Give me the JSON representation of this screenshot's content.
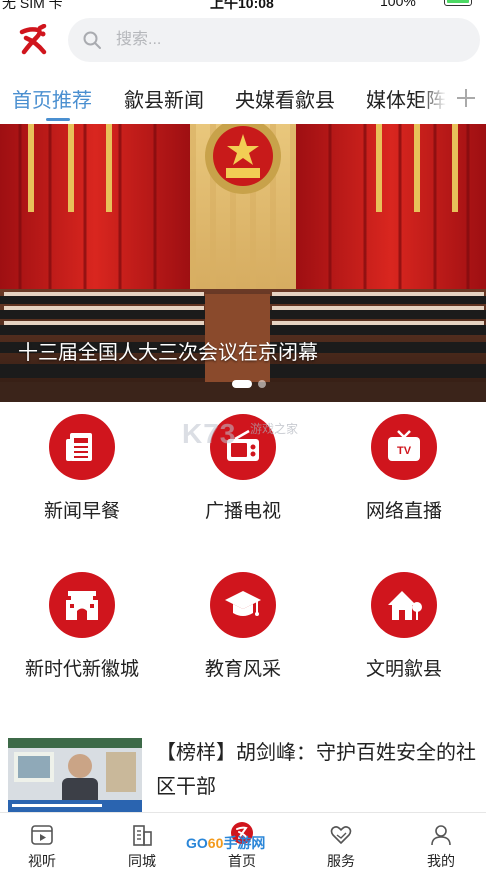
{
  "status_bar": {
    "carrier": "无 SIM 卡",
    "time": "上午10:08",
    "battery": "100%"
  },
  "header": {
    "logo_icon": "red-calligraphy-logo-icon",
    "search_placeholder": "搜索..."
  },
  "tabs": [
    {
      "label": "首页推荐",
      "active": true
    },
    {
      "label": "歙县新闻",
      "active": false
    },
    {
      "label": "央媒看歙县",
      "active": false
    },
    {
      "label": "媒体矩阵",
      "active": false
    }
  ],
  "banner": {
    "caption": "十三届全国人大三次会议在京闭幕",
    "slide_count": 2,
    "active_slide": 1
  },
  "grid": [
    {
      "label": "新闻早餐",
      "icon": "newspaper-icon"
    },
    {
      "label": "广播电视",
      "icon": "radio-icon"
    },
    {
      "label": "网络直播",
      "icon": "tv-live-icon"
    },
    {
      "label": "新时代新徽城",
      "icon": "city-gate-icon"
    },
    {
      "label": "教育风采",
      "icon": "graduation-cap-icon"
    },
    {
      "label": "文明歙县",
      "icon": "house-icon"
    }
  ],
  "watermark": {
    "text": "K73",
    "sub": "游戏之家"
  },
  "news": [
    {
      "title": "【榜样】胡剑峰：守护百姓安全的社区干部"
    }
  ],
  "bottom_nav": [
    {
      "label": "视听",
      "icon": "video-play-icon"
    },
    {
      "label": "同城",
      "icon": "building-icon"
    },
    {
      "label": "首页",
      "icon": "home-logo-icon"
    },
    {
      "label": "服务",
      "icon": "heart-hands-icon"
    },
    {
      "label": "我的",
      "icon": "user-icon"
    }
  ],
  "site_watermark": {
    "prefix": "GO",
    "middle": "60",
    "suffix": "手游网"
  },
  "colors": {
    "accent_blue": "#4a8fd0",
    "brand_red": "#d0151d"
  }
}
